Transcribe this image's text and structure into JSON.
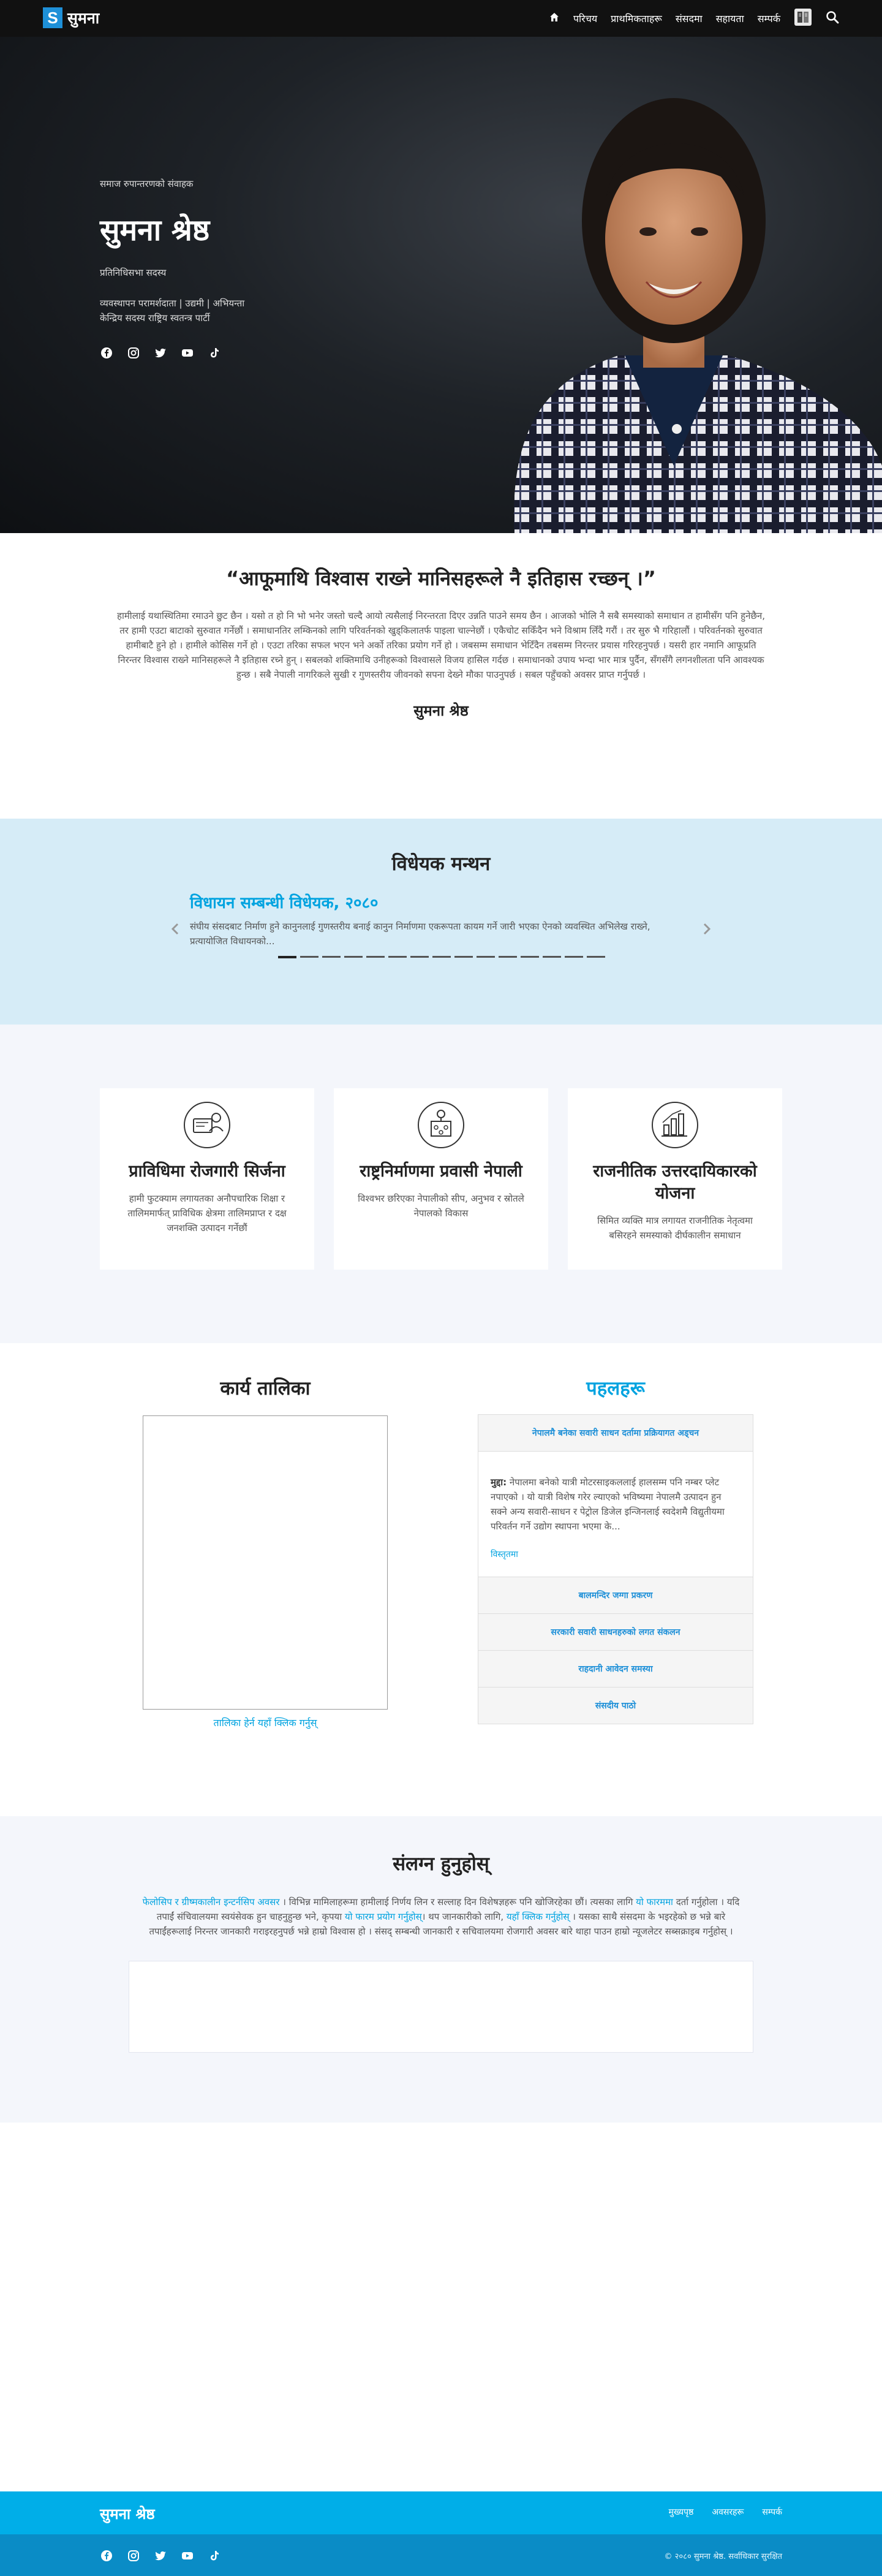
{
  "nav": {
    "logo_letter": "S",
    "logo_text": "सुमना",
    "items": [
      "परिचय",
      "प्राथमिकताहरू",
      "संसदमा",
      "सहायता",
      "सम्पर्क"
    ],
    "icons": [
      "home-icon",
      "book-icon",
      "search-icon"
    ]
  },
  "hero": {
    "kicker": "समाज रुपान्तरणको संवाहक",
    "name": "सुमना श्रेष्ठ",
    "role": "प्रतिनिधिसभा सदस्य",
    "bio_line1": "व्यवस्थापन परामर्शदाता | उद्यमी | अभियन्ता",
    "bio_line2": "केन्द्रिय सदस्य राष्ट्रिय स्वतन्त्र पार्टी",
    "social": [
      "facebook-icon",
      "instagram-icon",
      "twitter-icon",
      "youtube-icon",
      "tiktok-icon"
    ]
  },
  "quote": {
    "title": "“आफूमाथि विश्वास राख्ने मानिसहरूले नै इतिहास रच्छन् ।”",
    "body": "हामीलाई यथास्थितिमा रमाउने छुट छैन । यसो त हो नि भो भनेर जस्तो चल्दै आयो त्यसैलाई निरन्तरता दिएर उन्नति पाउने समय छैन । आजको भोलि नै सबै समस्याको समाधान त हामीसँग पनि हुनेछैन, तर हामी एउटा बाटाको सुरुवात गर्नेछौं । समाधानतिर लम्किनको लागि परिवर्तनको खुड्किलातर्फ पाइला चाल्नेछौं । एकैचोट सकिँदैन भने विश्राम लिँदै गरौं । तर सुरु भै गरिहालौं । परिवर्तनको सुरुवात हामीबाटै हुने हो । हामीले कोसिस गर्ने हो । एउटा तरिका सफल भएन भने अर्को तरिका प्रयोग गर्ने हो । जबसम्म समाधान भेटिँदैन तबसम्म निरन्तर प्रयास गरिरहनुपर्छ । यसरी हार नमानि आफूप्रति निरन्तर विश्वास राख्ने मानिसहरूले नै इतिहास रच्ने हुन् । सबलको शक्तिमाथि उनीहरूको विश्वासले विजय हासिल गर्दछ । समाधानको उपाय भन्दा भार मात्र पुर्दैन, सँगसँगै लगनशीलता पनि आवश्यक हुन्छ । सबै नेपाली नागरिकले सुखी र गुणस्तरीय जीवनको सपना देख्ने मौका पाउनुपर्छ । सबल पहुँचको अवसर प्राप्त गर्नुपर्छ ।",
    "signature": "सुमना श्रेष्ठ"
  },
  "bills": {
    "heading": "विधेयक मन्थन",
    "slide_title": "विधायन सम्बन्धी विधेयक, २०८०",
    "slide_desc": "संघीय संसदबाट निर्माण हुने कानुनलाई गुणस्तरीय बनाई कानुन निर्माणमा एकरूपता कायम गर्ने जारी भएका ऐनको व्यवस्थित अभिलेख राख्ने, प्रत्यायोजित विधायनको...",
    "dots": 15,
    "active_dot": 0
  },
  "programs": [
    {
      "icon": "employment-icon",
      "title": "प्राविधिमा रोजगारी सिर्जना",
      "desc": "हामी फुटक्याम लगायतका अनौपचारिक शिक्षा र तालिममार्फत् प्राविधिक क्षेत्रमा तालिमप्राप्त र दक्ष जनशक्ति उत्पादन गर्नेछौं"
    },
    {
      "icon": "network-icon",
      "title": "राष्ट्रनिर्माणमा प्रवासी नेपाली",
      "desc": "विश्वभर छरिएका नेपालीको सीप, अनुभव र स्रोतले नेपालको विकास"
    },
    {
      "icon": "accountability-icon",
      "title": "राजनीतिक उत्तरदायिकारको योजना",
      "desc": "सिमित व्यक्ति मात्र लगायत राजनीतिक नेतृत्वमा बसिरहने समस्याको दीर्घकालीन समाधान"
    }
  ],
  "schedule": {
    "heading": "कार्य तालिका",
    "link": "तालिका हेर्न यहाँ क्लिक गर्नुस्"
  },
  "initiatives": {
    "heading": "पहलहरू",
    "open_title": "नेपालमै बनेका सवारी साधन दर्तामा प्रक्रियागत अड्चन",
    "open_label": "मुद्दा:",
    "open_text": "नेपालमा बनेको यात्री मोटरसाइकललाई हालसम्म पनि नम्बर प्लेट नपाएको । यो यात्री विशेष गरेर ल्याएको भविष्यमा नेपालमै उत्पादन हुन सक्ने अन्य सवारी-साधन र पेट्रोल डिजेल इन्जिनलाई स्वदेशमै विद्युतीयमा परिवर्तन गर्ने उद्योग स्थापना भएमा के...",
    "open_more": "विस्तृतमा",
    "closed": [
      "बालमन्दिर जग्गा प्रकरण",
      "सरकारी सवारी साधनहरुको लगत संकलन",
      "राहदानी आवेदन समस्या",
      "संसदीय पाठो"
    ]
  },
  "connect": {
    "heading": "संलग्न हुनुहोस्",
    "link1": "फेलोसिप र ग्रीष्मकालीन इन्टर्नसिप अवसर",
    "text1": " । विभिन्न मामिलाहरूमा हामीलाई निर्णय लिन र सल्लाह दिन विशेषज्ञहरू पनि खोजिरहेका छौं। त्यसका लागि ",
    "link2": "यो फारममा",
    "text2": " दर्ता गर्नुहोला । यदि तपाईं संचिवालयमा स्वयंसेवक हुन चाहनुहुन्छ भने, कृपया ",
    "link3": "यो फारम प्रयोग गर्नुहोस्",
    "text3": "। थप जानकारीको लागि, ",
    "link4": "यहाँ क्लिक गर्नुहोस्",
    "text4": " । यसका साथै संसदमा के भइरहेको छ भन्ने बारे तपाईंहरूलाई निरन्तर जानकारी गराइरहनुपर्छ भन्ने हाम्रो विश्वास हो । संसद् सम्बन्धी जानकारी र सचिवालयमा रोजगारी अवसर बारे थाहा पाउन हाम्रो न्यूजलेटर सब्सक्राइब गर्नुहोस् ।"
  },
  "footer": {
    "brand": "सुमना श्रेष्ठ",
    "links": [
      "मुख्यपृष्ठ",
      "अवसरहरू",
      "सम्पर्क"
    ],
    "social": [
      "facebook-icon",
      "instagram-icon",
      "twitter-icon",
      "youtube-icon",
      "tiktok-icon"
    ],
    "copyright": "© २०८० सुमना श्रेष्ठ. सर्वाधिकार सुरक्षित"
  },
  "colors": {
    "accent": "#00a3e0",
    "nav_bg": "#111111",
    "bills_bg": "#d6ecf7",
    "footer_top": "#00aee8",
    "footer_bottom": "#0a8cc6"
  }
}
